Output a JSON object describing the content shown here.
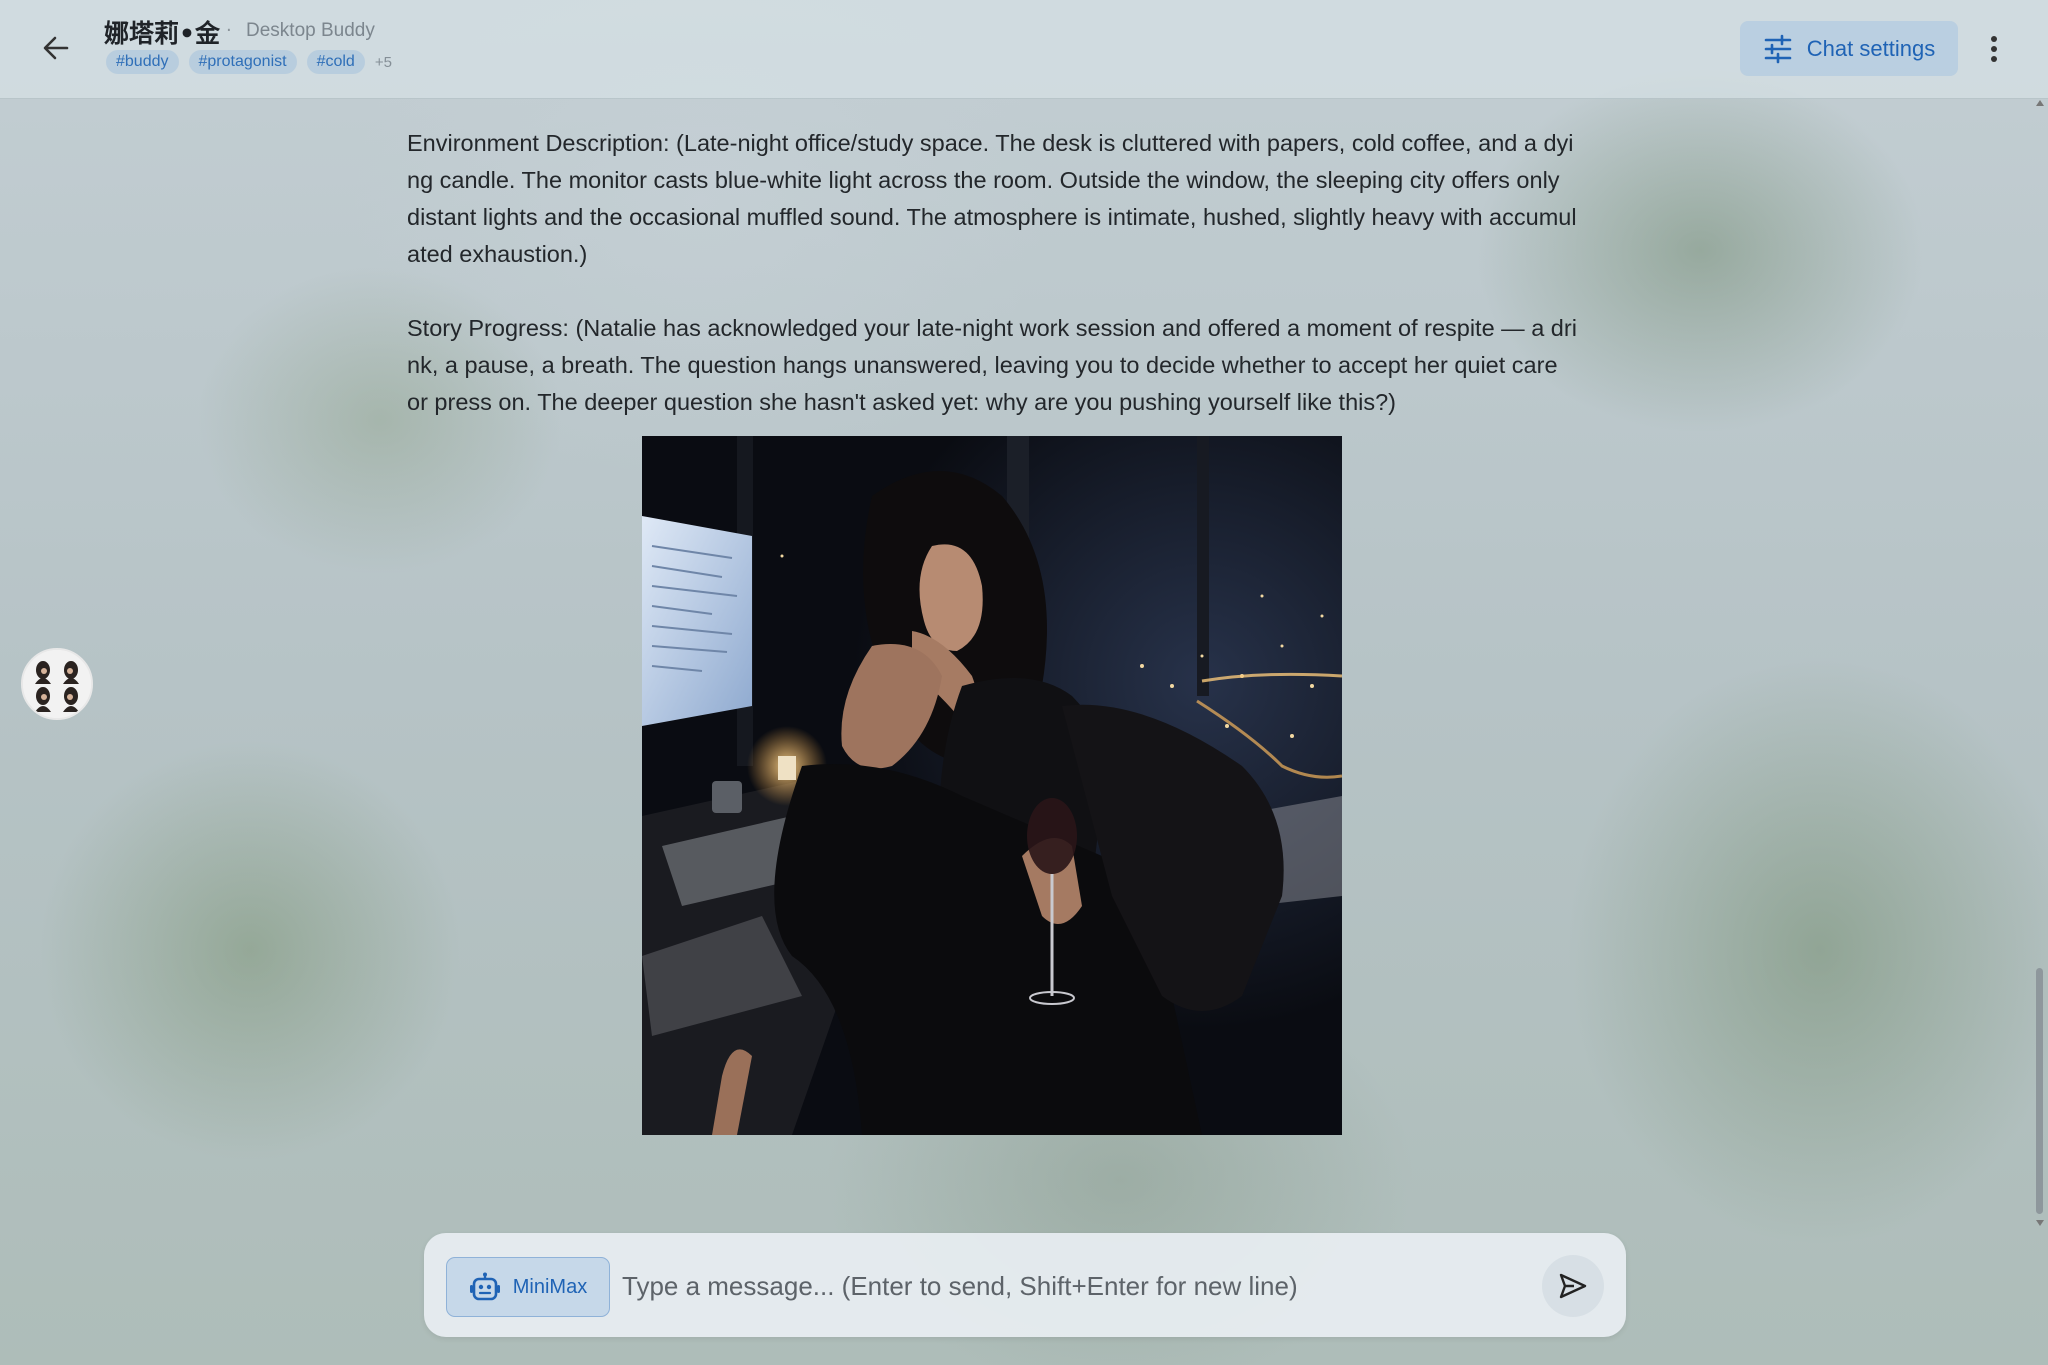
{
  "header": {
    "title": "娜塔莉•金",
    "subtitle_sep": "·",
    "subtitle": "Desktop Buddy",
    "tags": [
      "#buddy",
      "#protagonist",
      "#cold"
    ],
    "more_tags": "+5",
    "chat_settings_label": "Chat settings"
  },
  "message": {
    "environment": "Environment Description: (Late-night office/study space. The desk is cluttered with papers, cold coffee, and a dying candle. The monitor casts blue-white light across the room. Outside the window, the sleeping city offers only distant lights and the occasional muffled sound. The atmosphere is intimate, hushed, slightly heavy with accumulated exhaustion.)",
    "story": "Story Progress: (Natalie has acknowledged your late-night work session and offered a moment of respite — a drink, a pause, a breath. The question hangs unanswered, leaving you to decide whether to accept her quiet care or press on. The deeper question she hasn't asked yet: why are you pushing yourself like this?)"
  },
  "composer": {
    "model_label": "MiniMax",
    "placeholder": "Type a message... (Enter to send, Shift+Enter for new line)",
    "value": ""
  },
  "colors": {
    "accent": "#1f63b5",
    "tag_bg": "#b0c8de",
    "header_bg": "#d6e0e5"
  },
  "icons": {
    "back": "arrow-left-icon",
    "settings": "sliders-icon",
    "more": "more-vertical-icon",
    "model": "robot-icon",
    "send": "send-icon"
  }
}
